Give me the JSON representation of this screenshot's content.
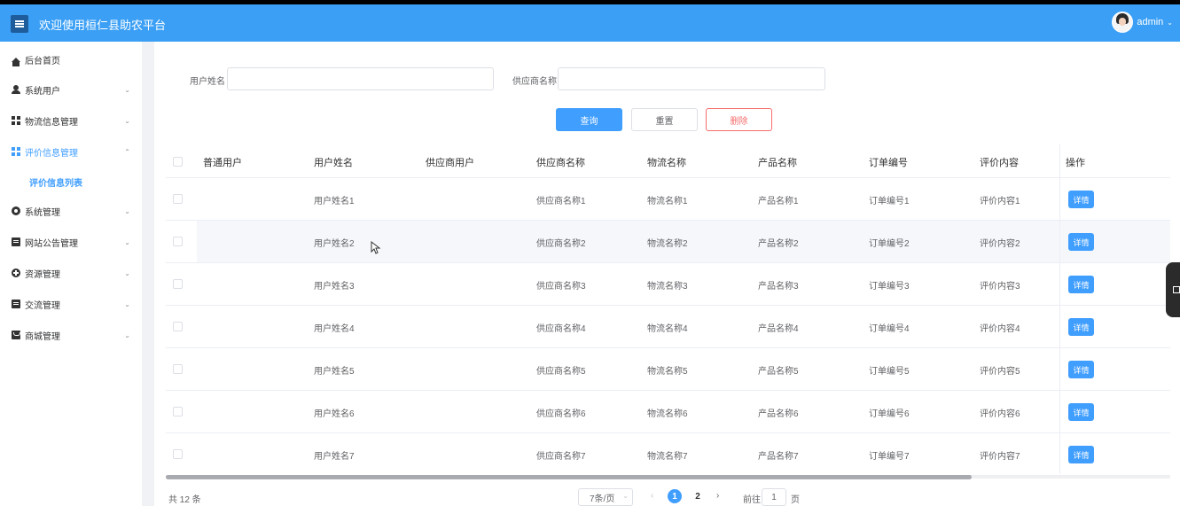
{
  "header": {
    "title": "欢迎使用桓仁县助农平台",
    "user": "admin",
    "menu_icon": "menu-icon",
    "caret": "⌄"
  },
  "sidebar": {
    "items": [
      {
        "label": "后台首页",
        "icon": "home-icon",
        "expandable": false
      },
      {
        "label": "系统用户",
        "icon": "user-icon",
        "expandable": true
      },
      {
        "label": "物流信息管理",
        "icon": "grid-icon",
        "expandable": true
      },
      {
        "label": "评价信息管理",
        "icon": "grid-icon",
        "expandable": true,
        "expanded": true
      },
      {
        "label": "系统管理",
        "icon": "gear-icon",
        "expandable": true
      },
      {
        "label": "网站公告管理",
        "icon": "doc-icon",
        "expandable": true
      },
      {
        "label": "资源管理",
        "icon": "plus-circle-icon",
        "expandable": true
      },
      {
        "label": "交流管理",
        "icon": "chat-icon",
        "expandable": true
      },
      {
        "label": "商城管理",
        "icon": "shop-icon",
        "expandable": true
      }
    ],
    "sub_item": "评价信息列表",
    "chevron_down": "⌄",
    "chevron_up": "⌃"
  },
  "search": {
    "username_label": "用户姓名",
    "username_value": "",
    "supplier_label": "供应商名称",
    "supplier_value": "",
    "query": "查询",
    "reset": "重置",
    "delete": "删除"
  },
  "table": {
    "columns": [
      "普通用户",
      "用户姓名",
      "供应商用户",
      "供应商名称",
      "物流名称",
      "产品名称",
      "订单编号",
      "评价内容",
      "操作"
    ],
    "rows": [
      {
        "user": "",
        "username": "用户姓名1",
        "supplier_user": "",
        "supplier": "供应商名称1",
        "logistics": "物流名称1",
        "product": "产品名称1",
        "order": "订单编号1",
        "review": "评价内容1"
      },
      {
        "user": "",
        "username": "用户姓名2",
        "supplier_user": "",
        "supplier": "供应商名称2",
        "logistics": "物流名称2",
        "product": "产品名称2",
        "order": "订单编号2",
        "review": "评价内容2"
      },
      {
        "user": "",
        "username": "用户姓名3",
        "supplier_user": "",
        "supplier": "供应商名称3",
        "logistics": "物流名称3",
        "product": "产品名称3",
        "order": "订单编号3",
        "review": "评价内容3"
      },
      {
        "user": "",
        "username": "用户姓名4",
        "supplier_user": "",
        "supplier": "供应商名称4",
        "logistics": "物流名称4",
        "product": "产品名称4",
        "order": "订单编号4",
        "review": "评价内容4"
      },
      {
        "user": "",
        "username": "用户姓名5",
        "supplier_user": "",
        "supplier": "供应商名称5",
        "logistics": "物流名称5",
        "product": "产品名称5",
        "order": "订单编号5",
        "review": "评价内容5"
      },
      {
        "user": "",
        "username": "用户姓名6",
        "supplier_user": "",
        "supplier": "供应商名称6",
        "logistics": "物流名称6",
        "product": "产品名称6",
        "order": "订单编号6",
        "review": "评价内容6"
      },
      {
        "user": "",
        "username": "用户姓名7",
        "supplier_user": "",
        "supplier": "供应商名称7",
        "logistics": "物流名称7",
        "product": "产品名称7",
        "order": "订单编号7",
        "review": "评价内容7"
      }
    ],
    "detail_label": "详情"
  },
  "pagination": {
    "total": "共 12 条",
    "page_size": "7条/页",
    "pages": [
      "1",
      "2"
    ],
    "current": "1",
    "prev": "‹",
    "next": "›",
    "goto_label": "前往",
    "goto_value": "1",
    "goto_suffix": "页"
  },
  "colors": {
    "header": "#3a9ff5",
    "accent": "#409eff",
    "danger": "#f56c6c"
  }
}
